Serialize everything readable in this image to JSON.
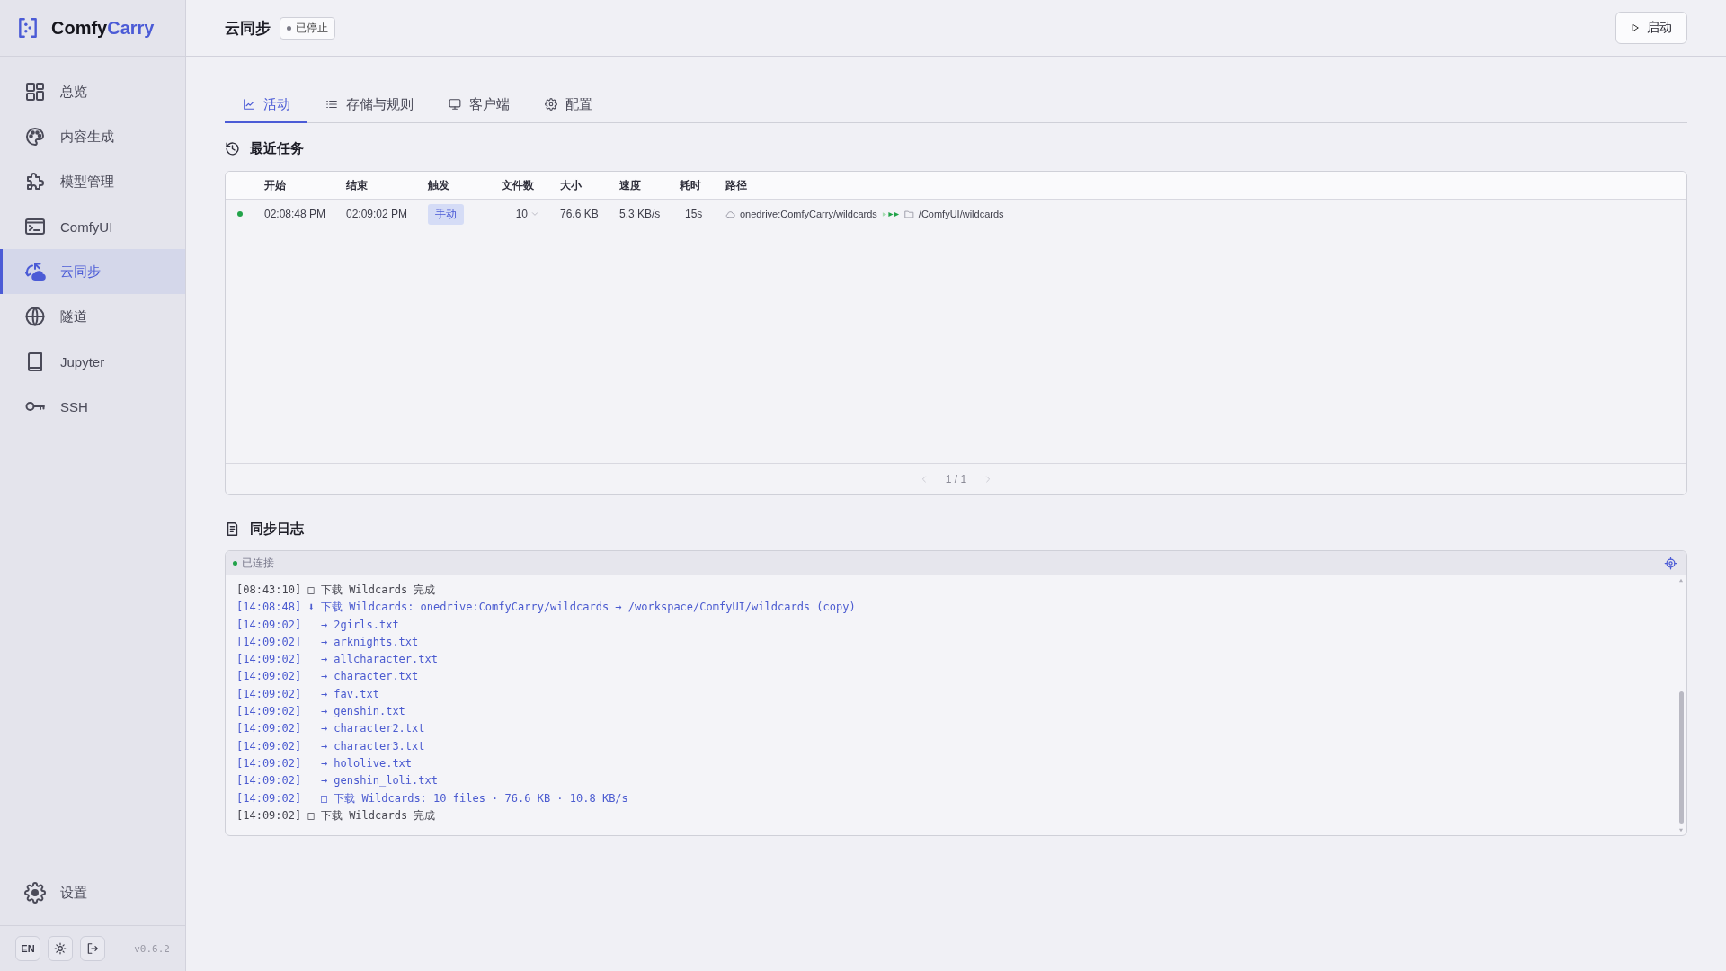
{
  "brand": {
    "prefix": "Comfy",
    "suffix": "Carry"
  },
  "sidebar": {
    "items": [
      {
        "label": "总览",
        "selected": false
      },
      {
        "label": "内容生成",
        "selected": false
      },
      {
        "label": "模型管理",
        "selected": false
      },
      {
        "label": "ComfyUI",
        "selected": false
      },
      {
        "label": "云同步",
        "selected": true
      },
      {
        "label": "隧道",
        "selected": false
      },
      {
        "label": "Jupyter",
        "selected": false
      },
      {
        "label": "SSH",
        "selected": false
      }
    ],
    "settings": {
      "label": "设置",
      "selected": false
    },
    "language": "EN",
    "version": "v0.6.2"
  },
  "header": {
    "title": "云同步",
    "status": {
      "label": "已停止",
      "running": false
    },
    "start_button": {
      "label": "启动"
    }
  },
  "tabs": [
    {
      "label": "活动",
      "selected": true
    },
    {
      "label": "存储与规则",
      "selected": false
    },
    {
      "label": "客户端",
      "selected": false
    },
    {
      "label": "配置",
      "selected": false
    }
  ],
  "recent_tasks": {
    "title": "最近任务",
    "columns": [
      "开始",
      "结束",
      "触发",
      "文件数",
      "大小",
      "速度",
      "耗时",
      "路径"
    ],
    "rows": [
      {
        "color": "#22a34a",
        "start": "02:08:48 PM",
        "end": "02:09:02 PM",
        "trigger": "手动",
        "files": "10",
        "expanded": false,
        "size": "76.6 KB",
        "speed": "5.3 KB/s",
        "duration": "15s",
        "source": "onedrive:ComfyCarry/wildcards",
        "destination": "/ComfyUI/wildcards"
      }
    ],
    "pagination": {
      "label": "1 / 1",
      "prev": {
        "disabled": true
      },
      "next": {
        "disabled": true
      }
    }
  },
  "sync_log": {
    "title": "同步日志",
    "connection": {
      "label": "已连接",
      "connected": true
    },
    "lines": [
      {
        "text": "[08:43:10] □ 下载 Wildcards 完成",
        "kind": "done"
      },
      {
        "text": "[14:08:48] ⬇ 下载 Wildcards: onedrive:ComfyCarry/wildcards → /workspace/ComfyUI/wildcards (copy)",
        "kind": "info"
      },
      {
        "text": "[14:09:02]   → 2girls.txt",
        "kind": "info"
      },
      {
        "text": "[14:09:02]   → arknights.txt",
        "kind": "info"
      },
      {
        "text": "[14:09:02]   → allcharacter.txt",
        "kind": "info"
      },
      {
        "text": "[14:09:02]   → character.txt",
        "kind": "info"
      },
      {
        "text": "[14:09:02]   → fav.txt",
        "kind": "info"
      },
      {
        "text": "[14:09:02]   → genshin.txt",
        "kind": "info"
      },
      {
        "text": "[14:09:02]   → character2.txt",
        "kind": "info"
      },
      {
        "text": "[14:09:02]   → character3.txt",
        "kind": "info"
      },
      {
        "text": "[14:09:02]   → hololive.txt",
        "kind": "info"
      },
      {
        "text": "[14:09:02]   → genshin_loli.txt",
        "kind": "info"
      },
      {
        "text": "[14:09:02]   □ 下载 Wildcards: 10 files · 76.6 KB · 10.8 KB/s",
        "kind": "info"
      },
      {
        "text": "[14:09:02] □ 下载 Wildcards 完成",
        "kind": "done"
      }
    ]
  }
}
